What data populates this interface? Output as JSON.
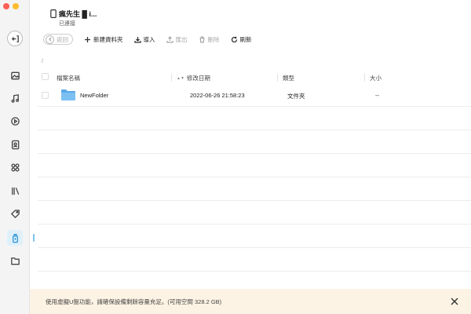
{
  "window": {
    "controls": [
      "close",
      "minimize"
    ]
  },
  "sidebar": {
    "items": [
      {
        "name": "back-icon"
      },
      {
        "name": "photos-icon"
      },
      {
        "name": "music-icon"
      },
      {
        "name": "video-icon"
      },
      {
        "name": "contacts-icon"
      },
      {
        "name": "apps-icon"
      },
      {
        "name": "books-icon"
      },
      {
        "name": "ringtones-icon"
      },
      {
        "name": "usb-drive-icon",
        "active": true
      },
      {
        "name": "files-icon"
      }
    ],
    "active_color": "#2b93d6"
  },
  "device": {
    "name": "瘋先生 █ i...",
    "status": "已連接"
  },
  "toolbar": {
    "back": "返回",
    "new_folder": "新建資料夾",
    "import": "導入",
    "export": "匯出",
    "delete": "刪除",
    "refresh": "刷新"
  },
  "path": "/",
  "table": {
    "headers": {
      "name": "檔案名稱",
      "date": "修改日期",
      "type": "類型",
      "size": "大小"
    },
    "sort_indicator": "▲▼",
    "rows": [
      {
        "name": "NewFolder",
        "date": "2022-06-26 21:58:23",
        "type": "文件夾",
        "size": "--",
        "icon": "folder-icon"
      }
    ]
  },
  "banner": {
    "text": "使用虛擬U盤功能，請確保設備剩餘容量充足。(可用空間 328.2 GB)",
    "background": "#fdf3e4"
  }
}
